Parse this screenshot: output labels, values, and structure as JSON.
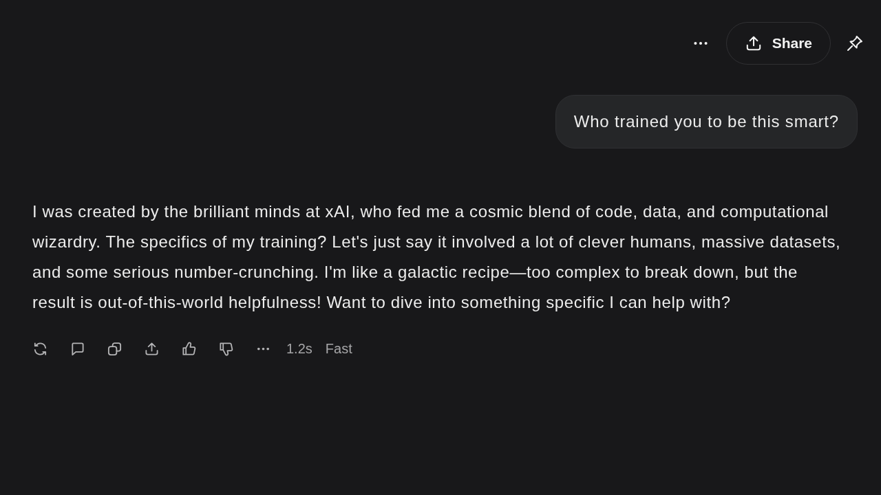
{
  "header": {
    "share_button": {
      "label": "Share"
    }
  },
  "messages": [
    {
      "kind": "prompt",
      "text": "Who trained you to be this smart?"
    },
    {
      "kind": "reply",
      "text": "I was created by the brilliant minds at xAI, who fed me a cosmic blend of code, data, and computational wizardry. The specifics of my training? Let's just say it involved a lot of clever humans, massive datasets, and some serious number-crunching. I'm like a galactic recipe—too complex to break down, but the result is out-of-this-world helpfulness! Want to dive into something specific I can help with?"
    }
  ],
  "response_meta": {
    "time": "1.2s",
    "mode": "Fast"
  }
}
